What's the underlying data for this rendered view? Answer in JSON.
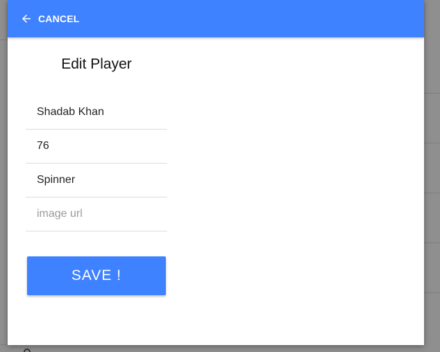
{
  "toolbar": {
    "cancel_label": "CANCEL",
    "back_icon": "arrow-left-icon"
  },
  "form": {
    "title": "Edit Player",
    "name_value": "Shadab Khan",
    "age_value": "76",
    "role_value": "Spinner",
    "image_placeholder": "image url",
    "image_value": "",
    "save_label": "SAVE !"
  },
  "colors": {
    "primary": "#3f82ff",
    "backdrop": "#8f8f8f"
  }
}
